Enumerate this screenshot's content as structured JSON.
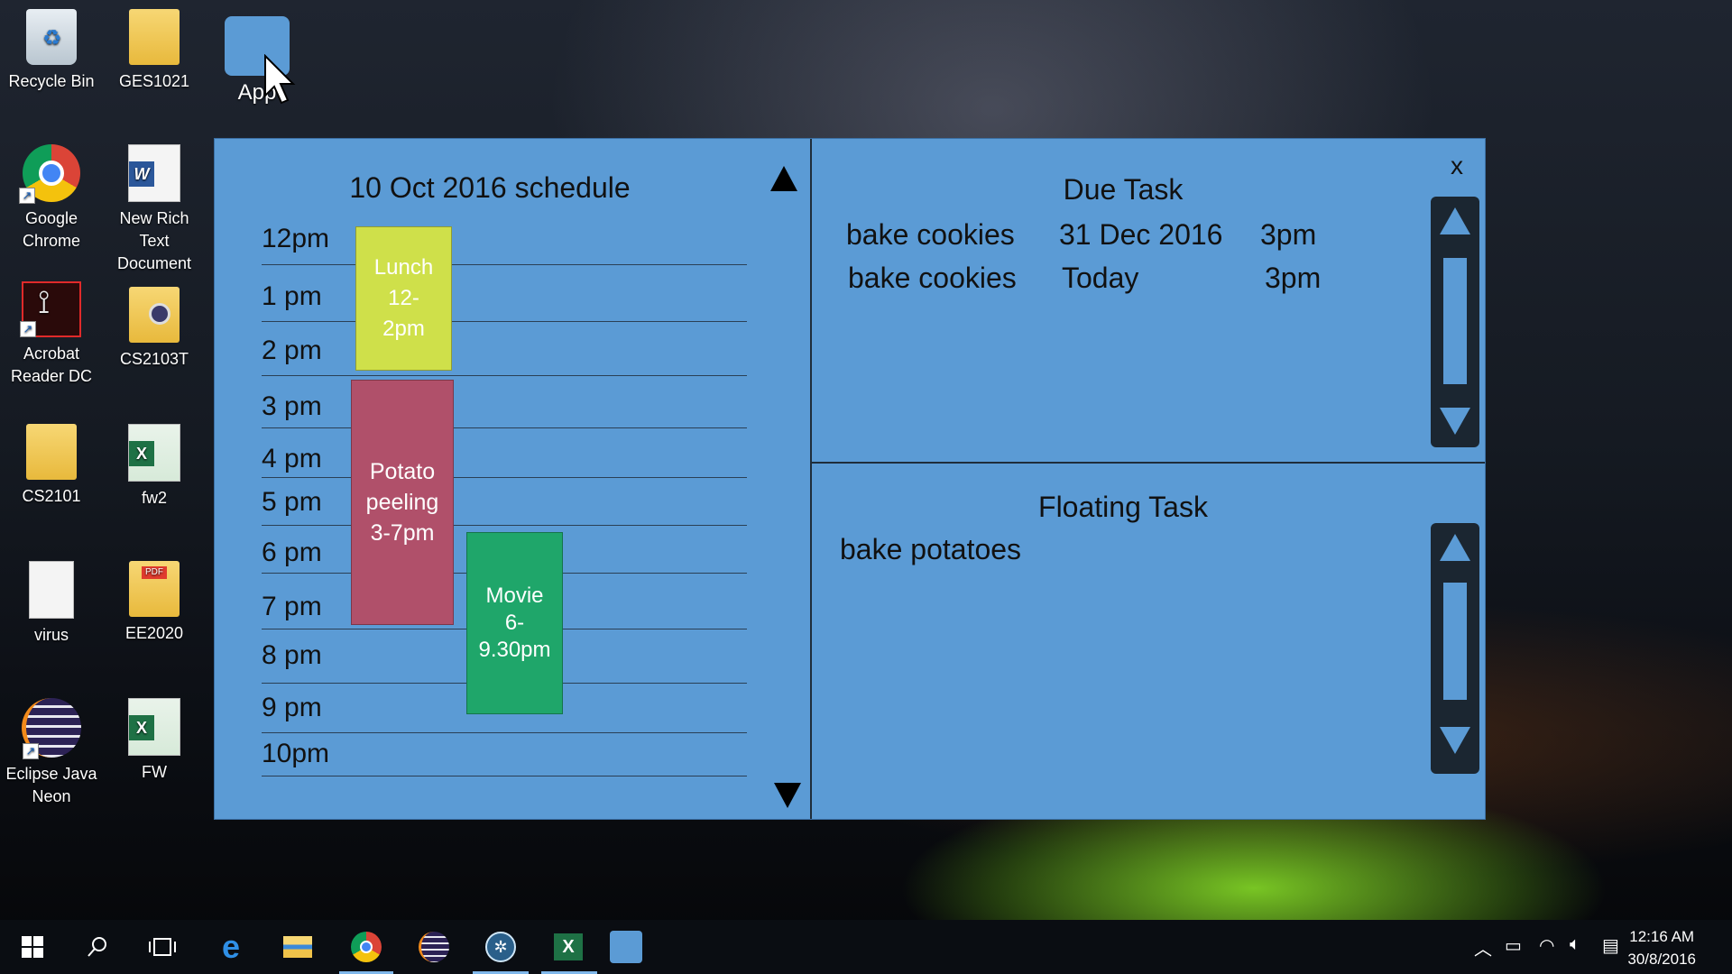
{
  "desktop": {
    "icons": [
      {
        "label_1": "Recycle Bin",
        "label_2": ""
      },
      {
        "label_1": "GES1021",
        "label_2": ""
      },
      {
        "label_1": "App",
        "label_2": ""
      },
      {
        "label_1": "Google",
        "label_2": "Chrome"
      },
      {
        "label_1": "New Rich Text",
        "label_2": "Document"
      },
      {
        "label_1": "Acrobat",
        "label_2": "Reader DC"
      },
      {
        "label_1": "CS2103T",
        "label_2": ""
      },
      {
        "label_1": "CS2101",
        "label_2": ""
      },
      {
        "label_1": "fw2",
        "label_2": ""
      },
      {
        "label_1": "virus",
        "label_2": ""
      },
      {
        "label_1": "EE2020",
        "label_2": ""
      },
      {
        "label_1": "Eclipse Java",
        "label_2": "Neon"
      },
      {
        "label_1": "FW",
        "label_2": ""
      }
    ]
  },
  "app": {
    "close_label": "x",
    "schedule": {
      "title": "10 Oct 2016 schedule",
      "hours": [
        "12pm",
        "1 pm",
        "2 pm",
        "3 pm",
        "4 pm",
        "5 pm",
        "6 pm",
        "7 pm",
        "8 pm",
        "9 pm",
        "10pm"
      ],
      "events": [
        {
          "lines": [
            "Lunch",
            "12-",
            "2pm"
          ],
          "color": "#cfe04a"
        },
        {
          "lines": [
            "Potato",
            "peeling",
            "3-7pm"
          ],
          "color": "#b0506a"
        },
        {
          "lines": [
            "Movie",
            "6-",
            "9.30pm"
          ],
          "color": "#1fa66a"
        }
      ]
    },
    "due": {
      "title": "Due Task",
      "rows": [
        {
          "name": "bake cookies",
          "date": "31 Dec 2016",
          "time": "3pm"
        },
        {
          "name": "bake cookies",
          "date": "Today",
          "time": "3pm"
        }
      ]
    },
    "floating": {
      "title": "Floating Task",
      "items": [
        "bake potatoes"
      ]
    }
  },
  "taskbar": {
    "time": "12:16 AM",
    "date": "30/8/2016"
  },
  "colors": {
    "window_bg": "#5b9bd5",
    "scrollbar": "#1b2631",
    "lunch": "#cfe04a",
    "potato": "#b0506a",
    "movie": "#1fa66a"
  }
}
